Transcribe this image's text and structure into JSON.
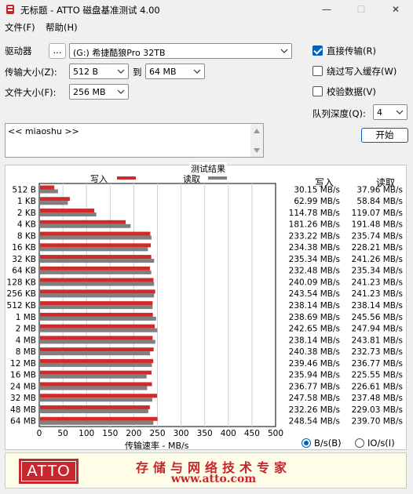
{
  "window": {
    "title": "无标题 - ATTO 磁盘基准测试 4.00",
    "minimize": "—",
    "maximize": "☐",
    "close": "✕"
  },
  "menu": {
    "file": "文件(F)",
    "help": "帮助(H)"
  },
  "drive": {
    "label": "驱动器",
    "browse": "...",
    "value": "(G:) 希捷酷狼Pro 32TB"
  },
  "transfer": {
    "label": "传输大小(Z):",
    "from": "512 B",
    "to_label": "到",
    "to": "64 MB"
  },
  "filesize": {
    "label": "文件大小(F):",
    "value": "256 MB"
  },
  "options": {
    "direct_io": {
      "label": "直接传输(R)",
      "checked": true
    },
    "bypass_write_cache": {
      "label": "绕过写入缓存(W)",
      "checked": false
    },
    "verify_data": {
      "label": "校验数据(V)",
      "checked": false
    },
    "queue_label": "队列深度(Q):",
    "queue_value": "4"
  },
  "start_button": "开始",
  "description": "<< miaoshu >>",
  "results": {
    "title": "测试结果",
    "legend_write": "写入",
    "legend_read": "读取",
    "col_write": "写入",
    "col_read": "读取",
    "xlabel": "传输速率 - MB/s",
    "colors": {
      "write": "#d12a2a",
      "read": "#7f7f7f"
    }
  },
  "chart_data": {
    "type": "bar",
    "title": "测试结果",
    "xlabel": "传输速率 - MB/s",
    "xlim": [
      0,
      500
    ],
    "xticks": [
      0,
      50,
      100,
      150,
      200,
      250,
      300,
      350,
      400,
      450,
      500
    ],
    "categories": [
      "512 B",
      "1 KB",
      "2 KB",
      "4 KB",
      "8 KB",
      "16 KB",
      "32 KB",
      "64 KB",
      "128 KB",
      "256 KB",
      "512 KB",
      "1 MB",
      "2 MB",
      "4 MB",
      "8 MB",
      "12 MB",
      "16 MB",
      "24 MB",
      "32 MB",
      "48 MB",
      "64 MB"
    ],
    "series": [
      {
        "name": "写入",
        "values": [
          30.15,
          62.99,
          114.78,
          181.26,
          233.22,
          234.38,
          235.34,
          232.48,
          240.09,
          243.54,
          238.14,
          238.69,
          242.65,
          238.14,
          240.38,
          239.46,
          235.94,
          236.77,
          247.58,
          232.26,
          248.54
        ]
      },
      {
        "name": "读取",
        "values": [
          37.96,
          58.84,
          119.07,
          191.48,
          235.74,
          228.21,
          241.26,
          235.34,
          241.23,
          241.23,
          238.14,
          245.56,
          247.94,
          243.81,
          232.73,
          236.77,
          225.55,
          226.61,
          237.48,
          229.03,
          239.7
        ]
      }
    ],
    "write_labels": [
      "30.15 MB/s",
      "62.99 MB/s",
      "114.78 MB/s",
      "181.26 MB/s",
      "233.22 MB/s",
      "234.38 MB/s",
      "235.34 MB/s",
      "232.48 MB/s",
      "240.09 MB/s",
      "243.54 MB/s",
      "238.14 MB/s",
      "238.69 MB/s",
      "242.65 MB/s",
      "238.14 MB/s",
      "240.38 MB/s",
      "239.46 MB/s",
      "235.94 MB/s",
      "236.77 MB/s",
      "247.58 MB/s",
      "232.26 MB/s",
      "248.54 MB/s"
    ],
    "read_labels": [
      "37.96 MB/s",
      "58.84 MB/s",
      "119.07 MB/s",
      "191.48 MB/s",
      "235.74 MB/s",
      "228.21 MB/s",
      "241.26 MB/s",
      "235.34 MB/s",
      "241.23 MB/s",
      "241.23 MB/s",
      "238.14 MB/s",
      "245.56 MB/s",
      "247.94 MB/s",
      "243.81 MB/s",
      "232.73 MB/s",
      "236.77 MB/s",
      "225.55 MB/s",
      "226.61 MB/s",
      "237.48 MB/s",
      "229.03 MB/s",
      "239.70 MB/s"
    ]
  },
  "units": {
    "bytes": "B/s(B)",
    "io": "IO/s(I)",
    "selected": "bytes"
  },
  "footer": {
    "logo": "ATTO",
    "slogan": "存储与网络技术专家",
    "url": "www.atto.com"
  }
}
